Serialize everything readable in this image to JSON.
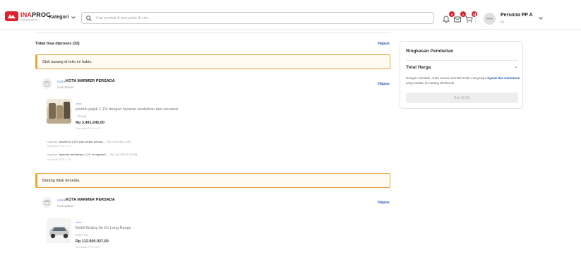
{
  "header": {
    "logo_word_accent": "INA",
    "logo_word_rest": "PROC",
    "logo_subtitle": "Katalog Elektronik",
    "kategori_label": "Kategori",
    "search_placeholder": "Cari produk & penyedia di sini...",
    "notification_count": "5",
    "inbox_count": "1",
    "cart_count": "33",
    "avatar_initials": "PPA",
    "user_name": "Persona PP A",
    "user_role": "pp"
  },
  "section": {
    "title": "Tidak bisa diproses (33)",
    "hapus_label": "Hapus"
  },
  "groups": [
    {
      "alert": "Stok barang di toko ini habis.",
      "store_tag": "UMKK",
      "store_name": "KOTA MARMER PERSADA",
      "store_city": "Kota Batam",
      "hapus_label": "Hapus",
      "product": {
        "category": "Jasa",
        "name": "produk pajak 1,1% dengan layanan tambahan dan asuransi",
        "qty": "- Orang",
        "price": "Rp 3.491.645,00",
        "tax_note": "Termasuk PPN 1,1%"
      },
      "services": [
        {
          "prefix": "Layanan:",
          "name": "asuransi 1,1% satu untuk semua...",
          "price": " - Rp 2.244,00 (1,00)",
          "tax_note": "Termasuk PPN 1,1%"
        },
        {
          "prefix": "Layanan:",
          "name": "layanan tambahan 1,1% menghasil...",
          "price": " - Rp 101.007,00 (0,00)",
          "tax_note": "Termasuk PPN 1,1%"
        }
      ]
    },
    {
      "alert": "Barang tidak tersedia.",
      "store_tag": "UMKK",
      "store_name": "KOTA MARMER PERSADA",
      "store_city": "Kota Batam",
      "hapus_label": "Hapus",
      "product": {
        "category": "Jasa",
        "name": "Mobil Wuling Air Ev Long Range",
        "qty": "2,00 Unit",
        "price": "Rp 112.000.037,00",
        "tax_note": "Termasuk PPN 12%"
      }
    }
  ],
  "summary": {
    "title": "Ringkasan Pembelian",
    "total_label": "Total Harga",
    "total_value": "-",
    "note_before": "Dengan membeli, Anda secara otomatis telah menyetujui ",
    "note_link": "Syarat dan Ketentuan",
    "note_after": " yang berlaku di Katalog Elektronik.",
    "buy_button": "Beli (0,00)"
  },
  "colors": {
    "brand_red": "#d9232d",
    "link_blue": "#2561b8",
    "alert_border": "#e8a33a"
  }
}
